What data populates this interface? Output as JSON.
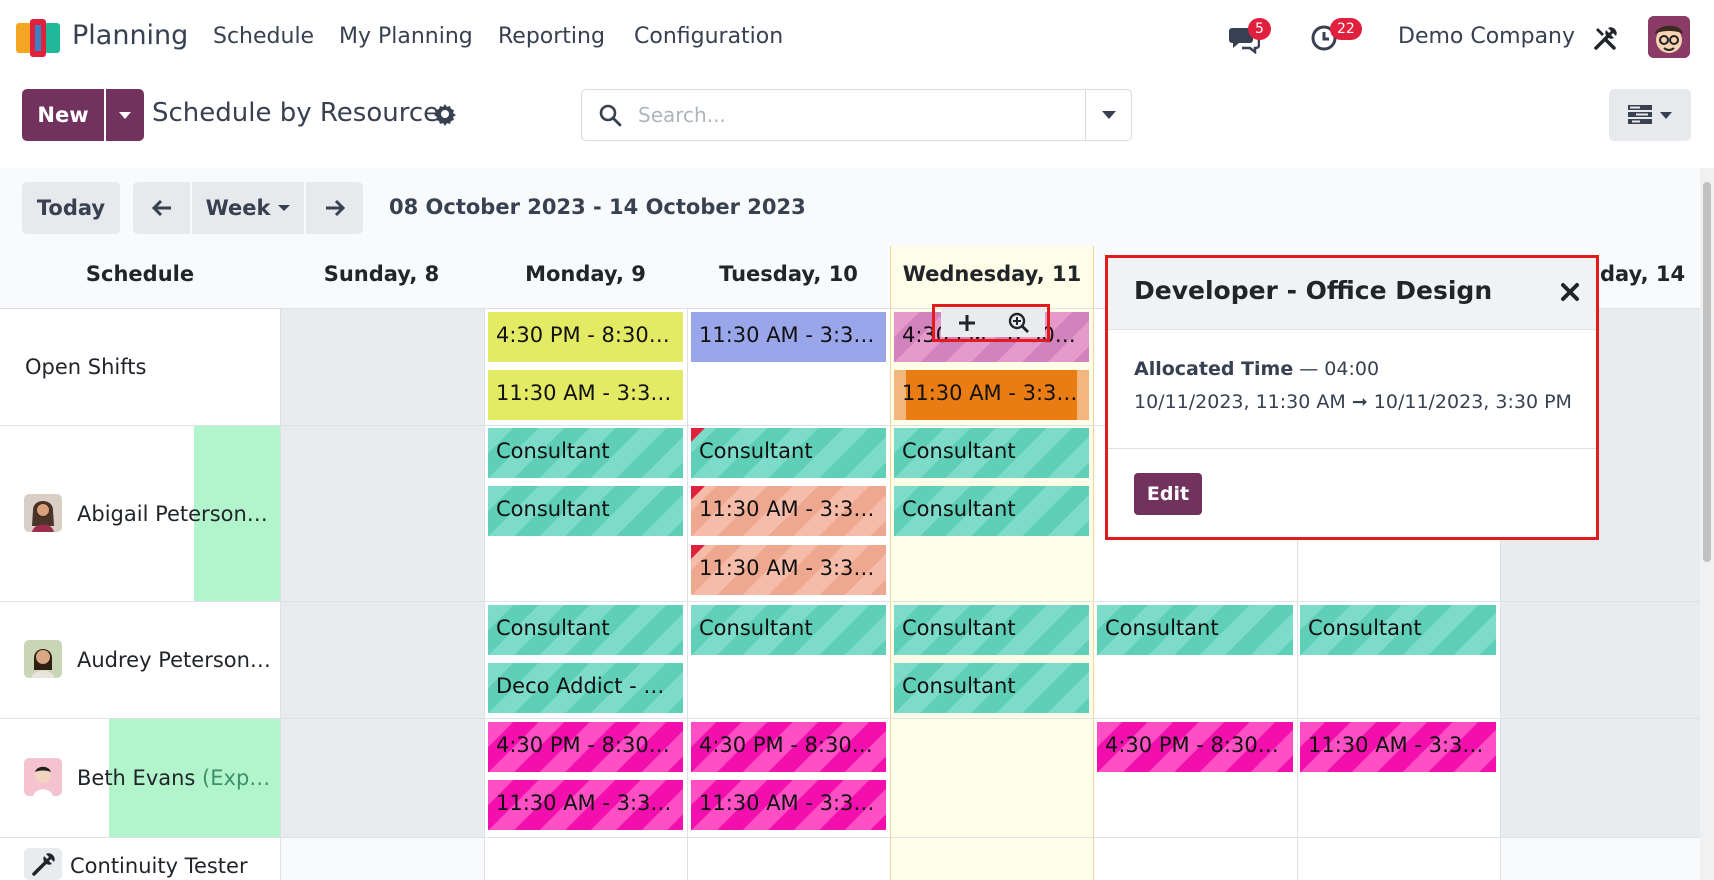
{
  "app": {
    "name": "Planning",
    "menu": [
      "Schedule",
      "My Planning",
      "Reporting",
      "Configuration"
    ],
    "messages_count": "5",
    "activities_count": "22",
    "company": "Demo Company"
  },
  "control": {
    "new_label": "New",
    "view_title": "Schedule by Resource",
    "search_placeholder": "Search..."
  },
  "nav": {
    "today_label": "Today",
    "scale_label": "Week",
    "range_text": "08 October 2023 - 14 October 2023"
  },
  "columns": {
    "schedule": "Schedule",
    "days": [
      "Sunday, 8",
      "Monday, 9",
      "Tuesday, 10",
      "Wednesday, 11",
      "",
      "day, 14"
    ]
  },
  "rows": {
    "open_shifts": "Open Shifts",
    "abigail": "Abigail Peterson…",
    "audrey": "Audrey Peterson…",
    "beth_name": "Beth Evans",
    "beth_suffix": " (Exp…",
    "continuity": "Continuity Tester"
  },
  "pills": {
    "open_mon_1": "4:30 PM - 8:30 …",
    "open_mon_2": "11:30 AM - 3:30…",
    "open_tue_1": "11:30 AM - 3:30…",
    "open_wed_1": "4:30 PM - 8:30 …",
    "open_wed_2": "11:30 AM - 3:30…",
    "consultant": "Consultant",
    "tue_salmon_1": "11:30 AM - 3:30…",
    "tue_salmon_2": "11:30 AM - 3:30…",
    "deco": "Deco Addict - C…",
    "beth_mon_1": "4:30 PM - 8:30 …",
    "beth_mon_2": "11:30 AM - 3:30…",
    "beth_tue_1": "4:30 PM - 8:30 …",
    "beth_tue_2": "11:30 AM - 3:30…",
    "beth_thu_1": "4:30 PM - 8:30 …",
    "beth_fri_1": "11:30 AM - 3:30…"
  },
  "popover": {
    "title": "Developer - Office Design",
    "allocated_label": "Allocated Time",
    "allocated_value": " — 04:00",
    "range": "10/11/2023, 11:30 AM ➞ 10/11/2023, 3:30 PM",
    "edit_label": "Edit"
  },
  "colors": {
    "brand": "#71325d",
    "badge": "#e1203e",
    "highlight_border": "#e21c1c"
  }
}
